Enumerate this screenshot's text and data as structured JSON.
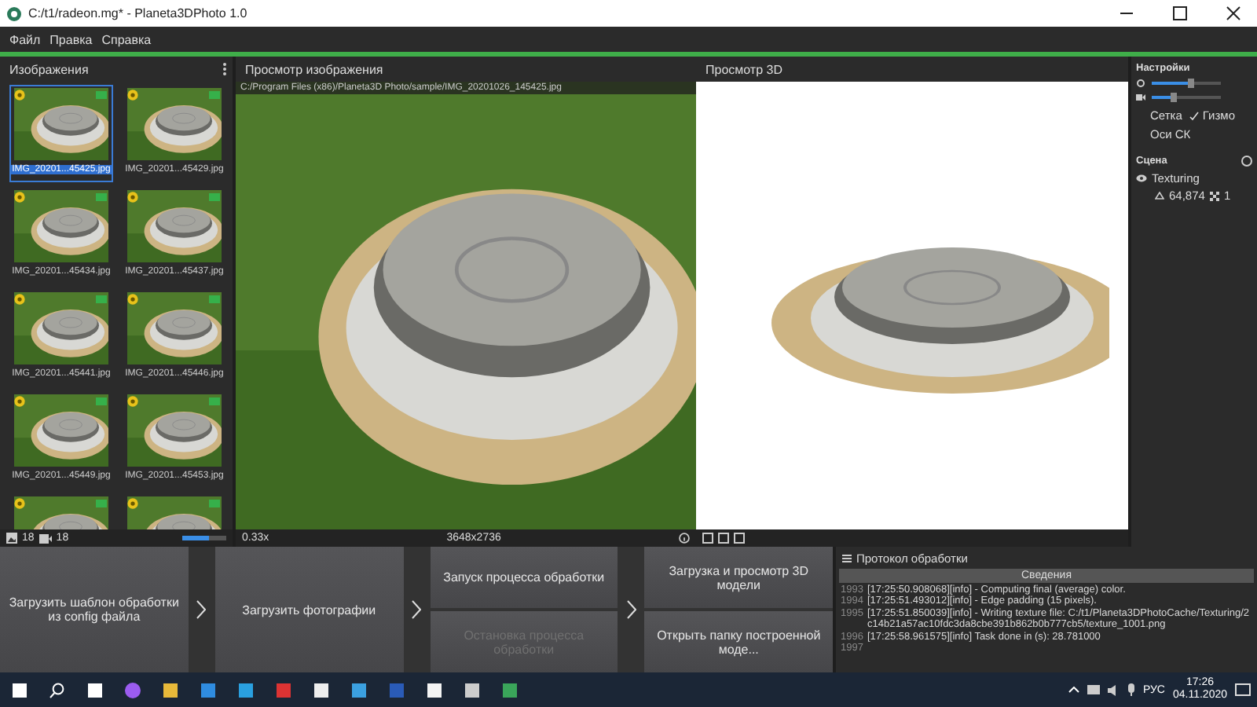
{
  "window": {
    "title": "C:/t1/radeon.mg* - Planeta3DPhoto 1.0"
  },
  "menu": [
    "Файл",
    "Правка",
    "Справка"
  ],
  "images_panel": {
    "title": "Изображения",
    "photo_count": "18",
    "camera_count": "18",
    "thumb_size": {
      "level": 0.6
    },
    "thumbnails": [
      {
        "name": "IMG_20201...45425.jpg",
        "selected": true
      },
      {
        "name": "IMG_20201...45429.jpg",
        "selected": false
      },
      {
        "name": "IMG_20201...45434.jpg",
        "selected": false
      },
      {
        "name": "IMG_20201...45437.jpg",
        "selected": false
      },
      {
        "name": "IMG_20201...45441.jpg",
        "selected": false
      },
      {
        "name": "IMG_20201...45446.jpg",
        "selected": false
      },
      {
        "name": "IMG_20201...45449.jpg",
        "selected": false
      },
      {
        "name": "IMG_20201...45453.jpg",
        "selected": false
      },
      {
        "selected": false
      },
      {
        "selected": false
      }
    ]
  },
  "image_view": {
    "title": "Просмотр изображения",
    "path": "C:/Program Files (x86)/Planeta3D Photo/sample/IMG_20201026_145425.jpg",
    "zoom": "0.33x",
    "resolution": "3648x2736"
  },
  "view_3d": {
    "title": "Просмотр 3D"
  },
  "settings": {
    "title": "Настройки",
    "sliders": [
      {
        "level": 0.55
      },
      {
        "level": 0.3
      }
    ],
    "options": [
      {
        "label": "Сетка",
        "checked": false
      },
      {
        "label": "Гизмо",
        "checked": true
      },
      {
        "label": "Оси СК",
        "checked": false
      }
    ]
  },
  "scene": {
    "title": "Сцена",
    "items": [
      {
        "name": "Texturing",
        "triangles": "64,874",
        "textures": "1"
      }
    ]
  },
  "actions": [
    {
      "buttons": [
        {
          "label": "Загрузить шаблон обработки из config файла",
          "disabled": false
        }
      ]
    },
    {
      "buttons": [
        {
          "label": "Загрузить фотографии",
          "disabled": false
        }
      ]
    },
    {
      "buttons": [
        {
          "label": "Запуск процесса обработки",
          "disabled": false
        },
        {
          "label": "Остановка процесса обработки",
          "disabled": true
        }
      ]
    },
    {
      "buttons": [
        {
          "label": "Загрузка и просмотр 3D модели",
          "disabled": false
        },
        {
          "label": "Открыть папку построенной моде...",
          "disabled": false
        }
      ]
    }
  ],
  "log": {
    "title": "Протокол обработки",
    "tab": "Сведения",
    "lines": [
      {
        "number": "1993",
        "text": "[17:25:50.908068][info]    - Computing final (average) color."
      },
      {
        "number": "1994",
        "text": "[17:25:51.493012][info]    - Edge padding (15 pixels)."
      },
      {
        "number": "1995",
        "text": "[17:25:51.850039][info]    - Writing texture file: C:/t1/Planeta3DPhotoCache/Texturing/2c14b21a57ac10fdc3da8cbe391b862b0b777cb5/texture_1001.png"
      },
      {
        "number": "1996",
        "text": "[17:25:58.961575][info] Task done in (s): 28.781000"
      },
      {
        "number": "1997"
      }
    ]
  },
  "taskbar": {
    "language": "РУС",
    "time": "17:26",
    "date": "04.11.2020"
  }
}
